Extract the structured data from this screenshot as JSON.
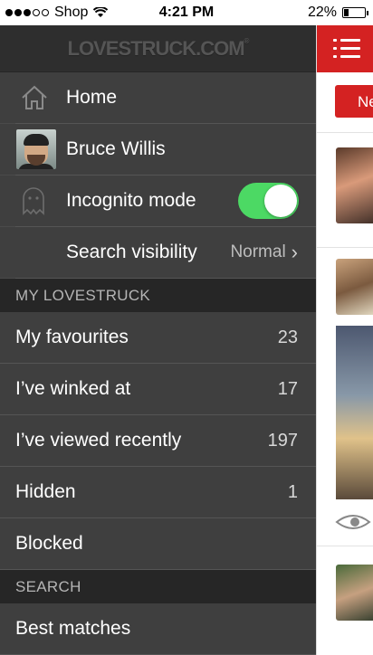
{
  "status_bar": {
    "carrier": "Shop",
    "time": "4:21 PM",
    "battery": "22%",
    "signal_bars_filled": 3,
    "signal_bars_total": 5,
    "battery_level": 0.22
  },
  "drawer": {
    "logo": "LOVESTRUCK.COM",
    "logo_mark": "®",
    "home_label": "Home",
    "user_name": "Bruce Willis",
    "incognito_label": "Incognito mode",
    "incognito_on": true,
    "search_visibility_label": "Search visibility",
    "search_visibility_value": "Normal",
    "sections": [
      {
        "title": "MY LOVESTRUCK",
        "items": [
          {
            "label": "My favourites",
            "count": "23"
          },
          {
            "label": "I’ve winked at",
            "count": "17"
          },
          {
            "label": "I’ve viewed recently",
            "count": "197"
          },
          {
            "label": "Hidden",
            "count": "1"
          },
          {
            "label": "Blocked",
            "count": ""
          }
        ]
      },
      {
        "title": "SEARCH",
        "items": [
          {
            "label": "Best matches",
            "count": ""
          }
        ]
      }
    ]
  },
  "content": {
    "new_button_label": "Ne"
  },
  "colors": {
    "brand_red": "#d42222",
    "toggle_on": "#4cd964",
    "drawer_bg": "#3f3f3f",
    "section_bg": "#262626"
  },
  "icons": [
    "wifi-icon",
    "home-icon",
    "ghost-icon",
    "chevron-right-icon",
    "menu-icon",
    "eye-icon"
  ]
}
